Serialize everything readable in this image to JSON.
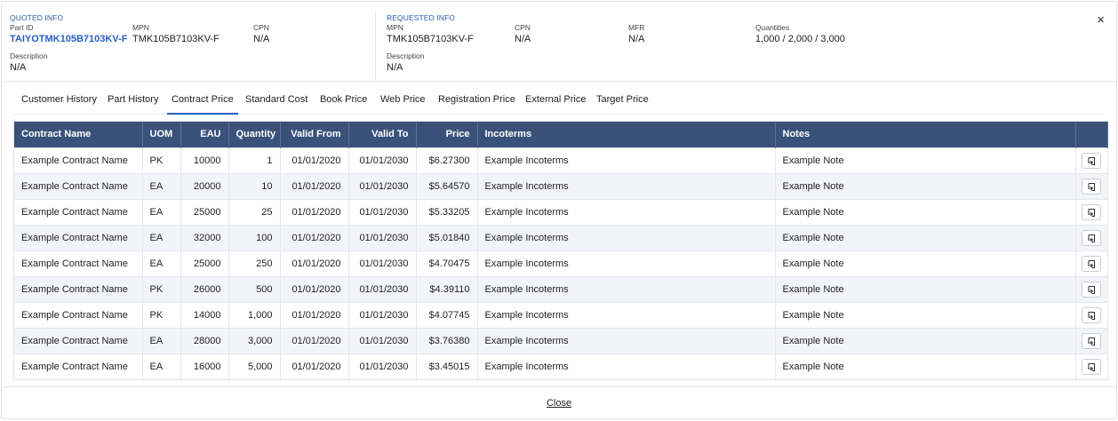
{
  "close_icon": "×",
  "quoted": {
    "title": "QUOTED INFO",
    "part_id_label": "Part ID",
    "part_id": "TAIYOTMK105B7103KV-F",
    "mpn_label": "MPN",
    "mpn": "TMK105B7103KV-F",
    "cpn_label": "CPN",
    "cpn": "N/A",
    "desc_label": "Description",
    "desc": "N/A"
  },
  "requested": {
    "title": "REQUESTED INFO",
    "mpn_label": "MPN",
    "mpn": "TMK105B7103KV-F",
    "cpn_label": "CPN",
    "cpn": "N/A",
    "mfr_label": "MFR",
    "mfr": "N/A",
    "qty_label": "Quantities",
    "qty": "1,000 / 2,000 / 3,000",
    "desc_label": "Description",
    "desc": "N/A"
  },
  "tabs": [
    {
      "label": "Customer History"
    },
    {
      "label": "Part History"
    },
    {
      "label": "Contract Price"
    },
    {
      "label": "Standard Cost"
    },
    {
      "label": "Book Price"
    },
    {
      "label": "Web Price"
    },
    {
      "label": "Registration Price"
    },
    {
      "label": "External Price"
    },
    {
      "label": "Target Price"
    }
  ],
  "active_tab": "Contract Price",
  "columns": {
    "contract_name": "Contract Name",
    "uom": "UOM",
    "eau": "EAU",
    "quantity": "Quantity",
    "valid_from": "Valid From",
    "valid_to": "Valid To",
    "price": "Price",
    "incoterms": "Incoterms",
    "notes": "Notes"
  },
  "rows": [
    {
      "name": "Example Contract Name",
      "uom": "PK",
      "eau": "10000",
      "qty": "1",
      "from": "01/01/2020",
      "to": "01/01/2030",
      "price": "$6.27300",
      "inco": "Example Incoterms",
      "notes": "Example Note"
    },
    {
      "name": "Example Contract Name",
      "uom": "EA",
      "eau": "20000",
      "qty": "10",
      "from": "01/01/2020",
      "to": "01/01/2030",
      "price": "$5.64570",
      "inco": "Example Incoterms",
      "notes": "Example Note"
    },
    {
      "name": "Example Contract Name",
      "uom": "EA",
      "eau": "25000",
      "qty": "25",
      "from": "01/01/2020",
      "to": "01/01/2030",
      "price": "$5.33205",
      "inco": "Example Incoterms",
      "notes": "Example Note"
    },
    {
      "name": "Example Contract Name",
      "uom": "EA",
      "eau": "32000",
      "qty": "100",
      "from": "01/01/2020",
      "to": "01/01/2030",
      "price": "$5.01840",
      "inco": "Example Incoterms",
      "notes": "Example Note"
    },
    {
      "name": "Example Contract Name",
      "uom": "EA",
      "eau": "25000",
      "qty": "250",
      "from": "01/01/2020",
      "to": "01/01/2030",
      "price": "$4.70475",
      "inco": "Example Incoterms",
      "notes": "Example Note"
    },
    {
      "name": "Example Contract Name",
      "uom": "PK",
      "eau": "26000",
      "qty": "500",
      "from": "01/01/2020",
      "to": "01/01/2030",
      "price": "$4.39110",
      "inco": "Example Incoterms",
      "notes": "Example Note"
    },
    {
      "name": "Example Contract Name",
      "uom": "PK",
      "eau": "14000",
      "qty": "1,000",
      "from": "01/01/2020",
      "to": "01/01/2030",
      "price": "$4.07745",
      "inco": "Example Incoterms",
      "notes": "Example Note"
    },
    {
      "name": "Example Contract Name",
      "uom": "EA",
      "eau": "28000",
      "qty": "3,000",
      "from": "01/01/2020",
      "to": "01/01/2030",
      "price": "$3.76380",
      "inco": "Example Incoterms",
      "notes": "Example Note"
    },
    {
      "name": "Example Contract Name",
      "uom": "EA",
      "eau": "16000",
      "qty": "5,000",
      "from": "01/01/2020",
      "to": "01/01/2030",
      "price": "$3.45015",
      "inco": "Example Incoterms",
      "notes": "Example Note"
    }
  ],
  "row_action_icon": "apply-price-icon",
  "footer": {
    "close_label": "Close"
  },
  "colors": {
    "header_bg": "#3a527a",
    "accent": "#2762c4",
    "row_alt": "#f3f4f8"
  }
}
